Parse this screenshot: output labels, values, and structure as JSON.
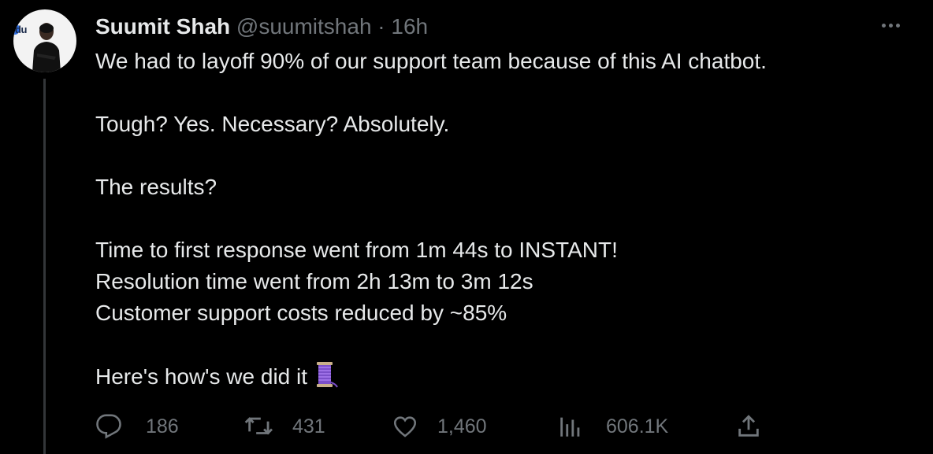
{
  "author": {
    "name": "Suumit Shah",
    "handle": "@suumitshah",
    "separator": "·",
    "time": "16h",
    "avatar_logo_text": "du"
  },
  "tweet": {
    "lines": [
      "We had to layoff 90% of our support team because of this AI chatbot.",
      "",
      "Tough? Yes. Necessary? Absolutely.",
      "",
      "The results?",
      "",
      "Time to first response went from 1m 44s to INSTANT!",
      "Resolution time went from 2h 13m to 3m 12s",
      "Customer support costs reduced by ~85%",
      "",
      "Here's how's we did it"
    ],
    "trailing_emoji": "thread-spool-icon"
  },
  "actions": {
    "replies": "186",
    "retweets": "431",
    "likes": "1,460",
    "views": "606.1K"
  },
  "colors": {
    "background": "#000000",
    "text": "#e7e9ea",
    "muted": "#71767b",
    "thread_line": "#333639"
  }
}
